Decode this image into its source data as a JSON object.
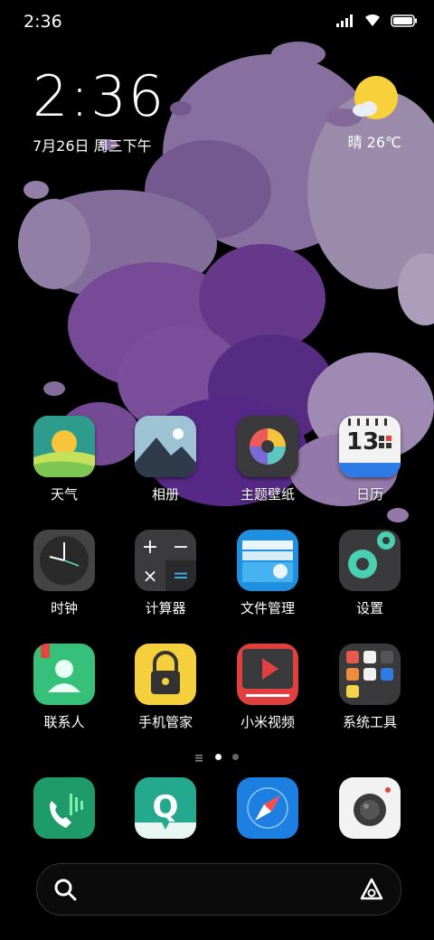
{
  "status_bar": {
    "time": "2:36",
    "icons": [
      "signal-icon",
      "wifi-icon",
      "battery-icon"
    ]
  },
  "lock_clock": {
    "time": "2:36",
    "date": "7月26日 周三下午"
  },
  "weather": {
    "text": "晴 26℃",
    "icon": "sunny-cloud-icon"
  },
  "apps": {
    "row1": [
      {
        "label": "天气"
      },
      {
        "label": "相册"
      },
      {
        "label": "主题壁纸"
      },
      {
        "label": "日历",
        "day": "13"
      }
    ],
    "row2": [
      {
        "label": "时钟"
      },
      {
        "label": "计算器"
      },
      {
        "label": "文件管理"
      },
      {
        "label": "设置"
      }
    ],
    "row3": [
      {
        "label": "联系人"
      },
      {
        "label": "手机管家"
      },
      {
        "label": "小米视频"
      },
      {
        "label": "系统工具"
      }
    ]
  },
  "page_indicator": {
    "pages": 2,
    "current": 1
  },
  "dock": [
    {
      "name": "phone"
    },
    {
      "name": "messages"
    },
    {
      "name": "browser"
    },
    {
      "name": "camera"
    }
  ],
  "search": {
    "icon": "search-icon",
    "assistant_icon": "assistant-icon"
  },
  "colors": {
    "wallpaper_purple": "#8e6fa8",
    "wallpaper_dark_purple": "#5a2f8a"
  }
}
